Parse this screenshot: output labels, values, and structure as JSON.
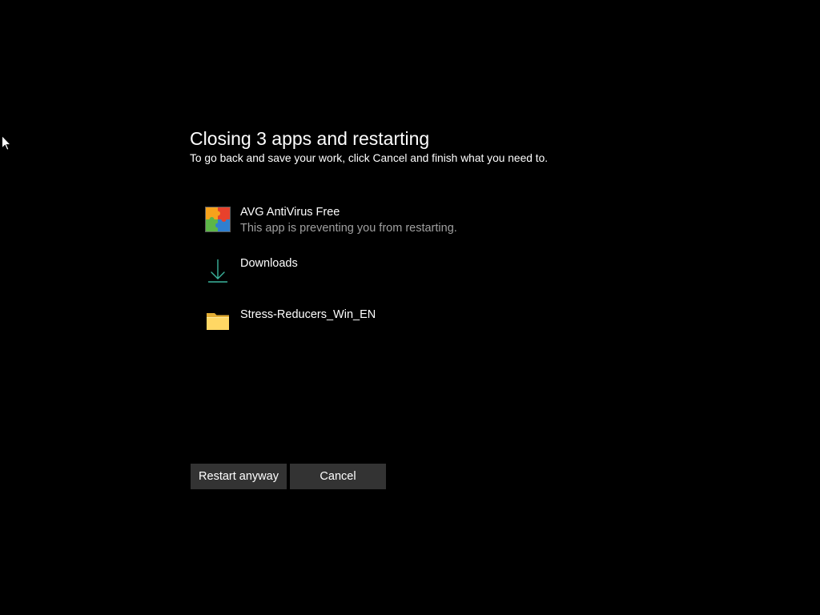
{
  "cursor": {
    "icon": "arrow-cursor-icon"
  },
  "dialog": {
    "title": "Closing 3 apps and restarting",
    "subtitle": "To go back and save your work, click Cancel and finish what you need to."
  },
  "apps": [
    {
      "name": "AVG AntiVirus Free",
      "status": "This app is preventing you from restarting.",
      "icon": "avg-antivirus-icon"
    },
    {
      "name": "Downloads",
      "icon": "download-arrow-icon"
    },
    {
      "name": "Stress-Reducers_Win_EN",
      "icon": "folder-icon"
    }
  ],
  "buttons": {
    "restart_anyway": "Restart anyway",
    "cancel": "Cancel"
  },
  "colors": {
    "background": "#000000",
    "text": "#ffffff",
    "secondary_text": "#a0a0a0",
    "button": "#333333",
    "downloads_icon": "#3bb59d",
    "folder": "#ffd764"
  }
}
